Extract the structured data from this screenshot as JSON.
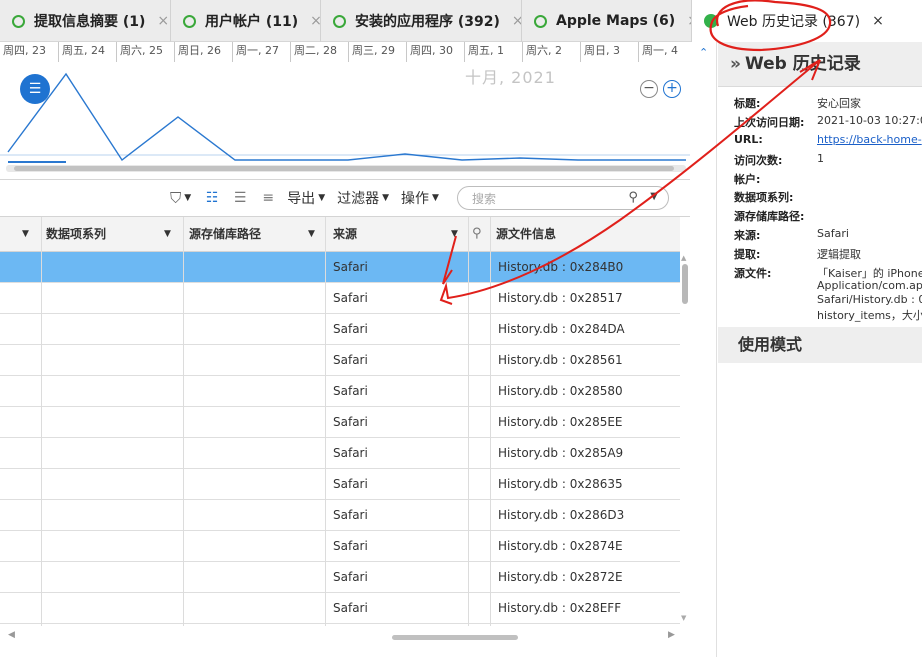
{
  "tabs": [
    {
      "label": "提取信息摘要 (1)",
      "close": "×"
    },
    {
      "label": "用户帐户 (11)",
      "close": "×"
    },
    {
      "label": "安装的应用程序 (392)",
      "close": "×"
    },
    {
      "label": "Apple Maps (6)",
      "close": "×"
    },
    {
      "label": "Web 历史记录 (367)",
      "close": "×"
    }
  ],
  "timeline": {
    "days": [
      "周四, 23",
      "周五, 24",
      "周六, 25",
      "周日, 26",
      "周一, 27",
      "周二, 28",
      "周三, 29",
      "周四, 30",
      "周五, 1",
      "周六, 2",
      "周日, 3",
      "周一, 4"
    ],
    "month": "十月, 2021",
    "zoom_out": "−",
    "zoom_in": "+"
  },
  "toolbar": {
    "export": "导出",
    "filter": "过滤器",
    "actions": "操作",
    "search_placeholder": "搜索"
  },
  "table": {
    "columns": [
      "数据项系列",
      "源存储库路径",
      "来源",
      "源文件信息"
    ],
    "rows": [
      {
        "source": "Safari",
        "file": "History.db : 0x284B0",
        "selected": true
      },
      {
        "source": "Safari",
        "file": "History.db : 0x28517"
      },
      {
        "source": "Safari",
        "file": "History.db : 0x284DA"
      },
      {
        "source": "Safari",
        "file": "History.db : 0x28561"
      },
      {
        "source": "Safari",
        "file": "History.db : 0x28580"
      },
      {
        "source": "Safari",
        "file": "History.db : 0x285EE"
      },
      {
        "source": "Safari",
        "file": "History.db : 0x285A9"
      },
      {
        "source": "Safari",
        "file": "History.db : 0x28635"
      },
      {
        "source": "Safari",
        "file": "History.db : 0x286D3"
      },
      {
        "source": "Safari",
        "file": "History.db : 0x2874E"
      },
      {
        "source": "Safari",
        "file": "History.db : 0x2872E"
      },
      {
        "source": "Safari",
        "file": "History.db : 0x28EFF"
      }
    ]
  },
  "detail": {
    "title": "Web 历史记录",
    "fields": [
      {
        "key": "标题:",
        "value": "安心回家"
      },
      {
        "key": "上次访问日期:",
        "value": "2021-10-03 10:27:0"
      },
      {
        "key": "URL:",
        "value": "https://back-home-"
      },
      {
        "key": "访问次数:",
        "value": "1"
      },
      {
        "key": "帐户:",
        "value": ""
      },
      {
        "key": "数据项系列:",
        "value": ""
      },
      {
        "key": "源存储库路径:",
        "value": ""
      },
      {
        "key": "来源:",
        "value": "Safari"
      },
      {
        "key": "提取:",
        "value": "逻辑提取"
      },
      {
        "key": "源文件:",
        "value": "「Kaiser」的 iPhone"
      },
      {
        "key": "",
        "value": "Application/com.ap"
      },
      {
        "key": "",
        "value": "Safari/History.db : 0"
      },
      {
        "key": "",
        "value": "history_items，大小"
      }
    ],
    "usage_title": "使用模式"
  },
  "colors": {
    "accent": "#1f73d1",
    "selected_row": "#6cb8f3",
    "tab_ok": "#3aa83a",
    "annotation": "#e0201b"
  }
}
